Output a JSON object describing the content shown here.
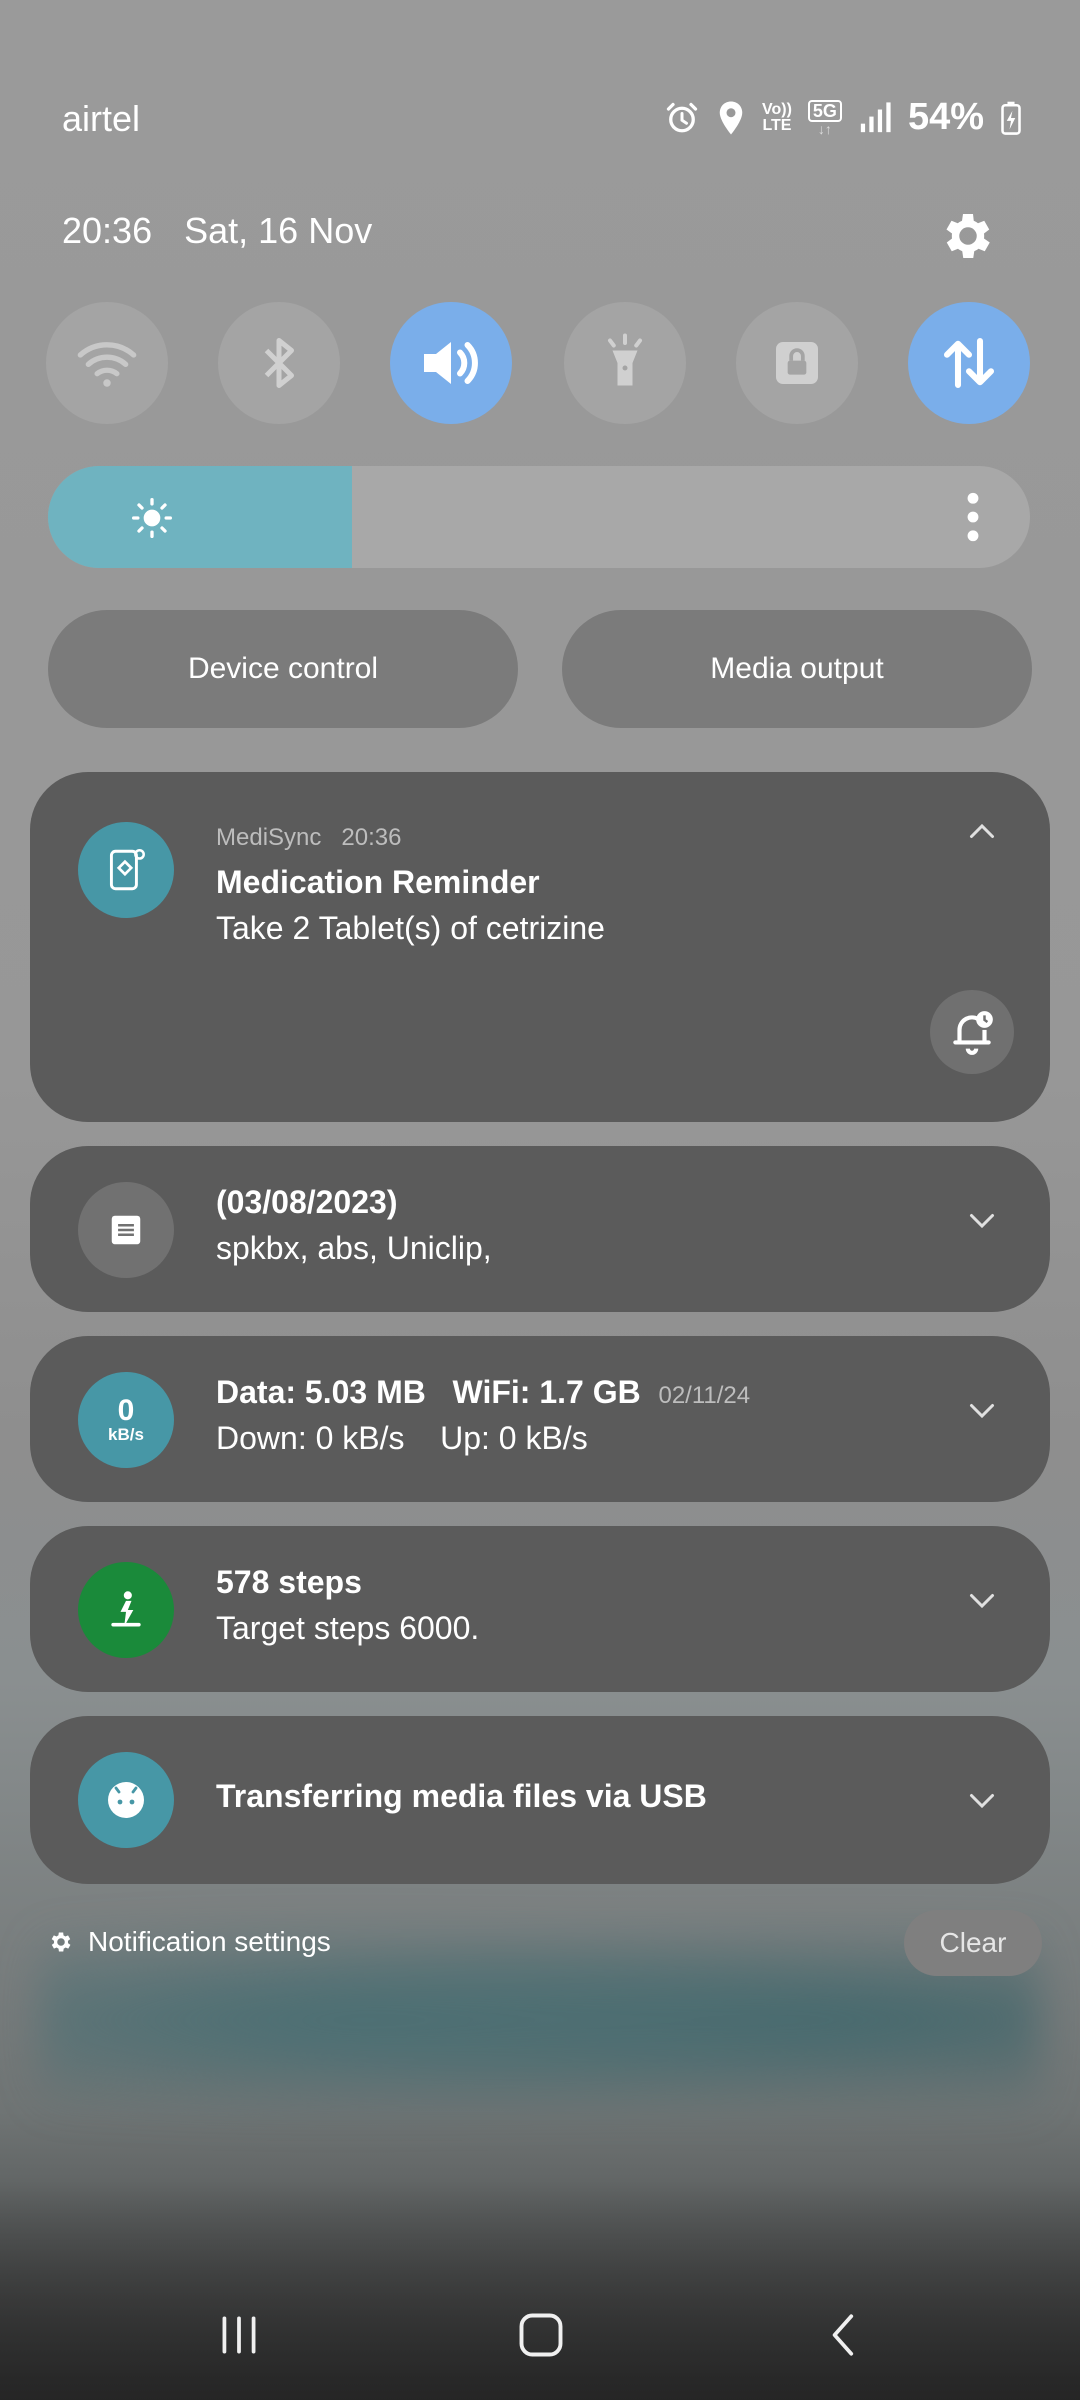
{
  "status_bar": {
    "carrier": "airtel",
    "volte_top": "Vo))",
    "volte_bottom": "LTE",
    "network": "5G",
    "battery_percent": "54%"
  },
  "header": {
    "time": "20:36",
    "date": "Sat, 16 Nov"
  },
  "quick_toggles": [
    {
      "name": "wifi",
      "active": false
    },
    {
      "name": "bluetooth",
      "active": false
    },
    {
      "name": "sound",
      "active": true
    },
    {
      "name": "flashlight",
      "active": false
    },
    {
      "name": "portrait-lock",
      "active": false
    },
    {
      "name": "mobile-data",
      "active": true
    }
  ],
  "brightness": {
    "level": 0.31
  },
  "buttons": {
    "device_control": "Device control",
    "media_output": "Media output"
  },
  "notifications": {
    "medisync": {
      "app": "MediSync",
      "time": "20:36",
      "title": "Medication Reminder",
      "body": "Take 2 Tablet(s) of cetrizine"
    },
    "note": {
      "title": "(03/08/2023)",
      "body": "spkbx, abs, Uniclip,"
    },
    "data_usage": {
      "icon_value": "0",
      "icon_unit": "kB/s",
      "title": "Data: 5.03 MB   WiFi: 1.7 GB",
      "date": "02/11/24",
      "body": "Down: 0 kB/s    Up: 0 kB/s"
    },
    "steps": {
      "title": "578 steps",
      "body": "Target steps 6000."
    },
    "usb": {
      "title": "Transferring media files via USB"
    }
  },
  "footer": {
    "notification_settings": "Notification settings",
    "clear": "Clear"
  },
  "colors": {
    "accent_blue": "#7aaeea",
    "brightness_fill": "#6fb3c0",
    "teal_icon": "#4797a6",
    "steps_green": "#1a8a3a",
    "card_bg": "#5b5b5b"
  }
}
